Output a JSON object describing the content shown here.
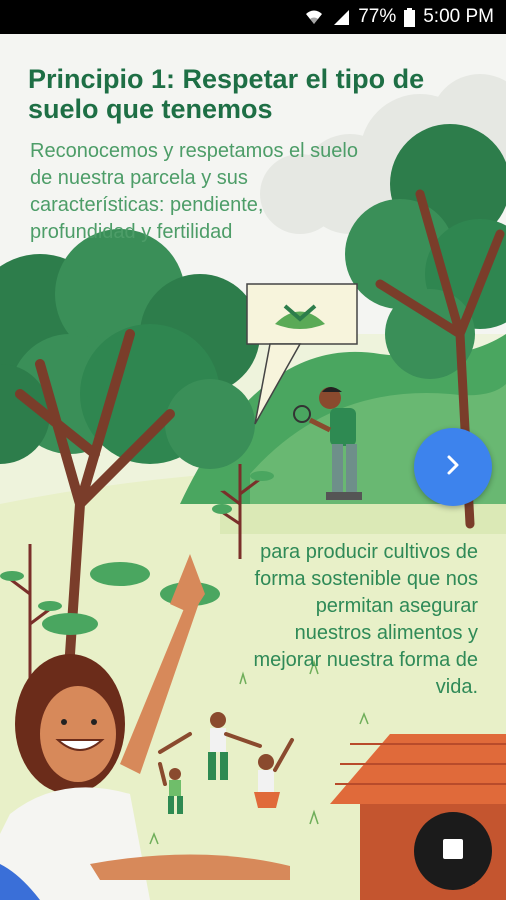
{
  "status": {
    "battery": "77%",
    "time": "5:00 PM"
  },
  "slide": {
    "title": "Principio 1: Respetar el tipo de suelo que tenemos",
    "intro": "Reconocemos y respetamos el suelo de nuestra parcela y sus características: pendiente, profundidad y fertilidad",
    "caption": "para producir cultivos de forma sostenible que nos permitan asegurar nuestros alimentos y mejorar nuestra forma de vida."
  },
  "icons": {
    "next": "chevron-right-icon",
    "stop": "stop-icon",
    "speech": "handshake-icon"
  },
  "colors": {
    "title": "#1e6f45",
    "text": "#4d9d68",
    "next_button": "#3d83ed",
    "stop_button": "#1b1b1b"
  }
}
